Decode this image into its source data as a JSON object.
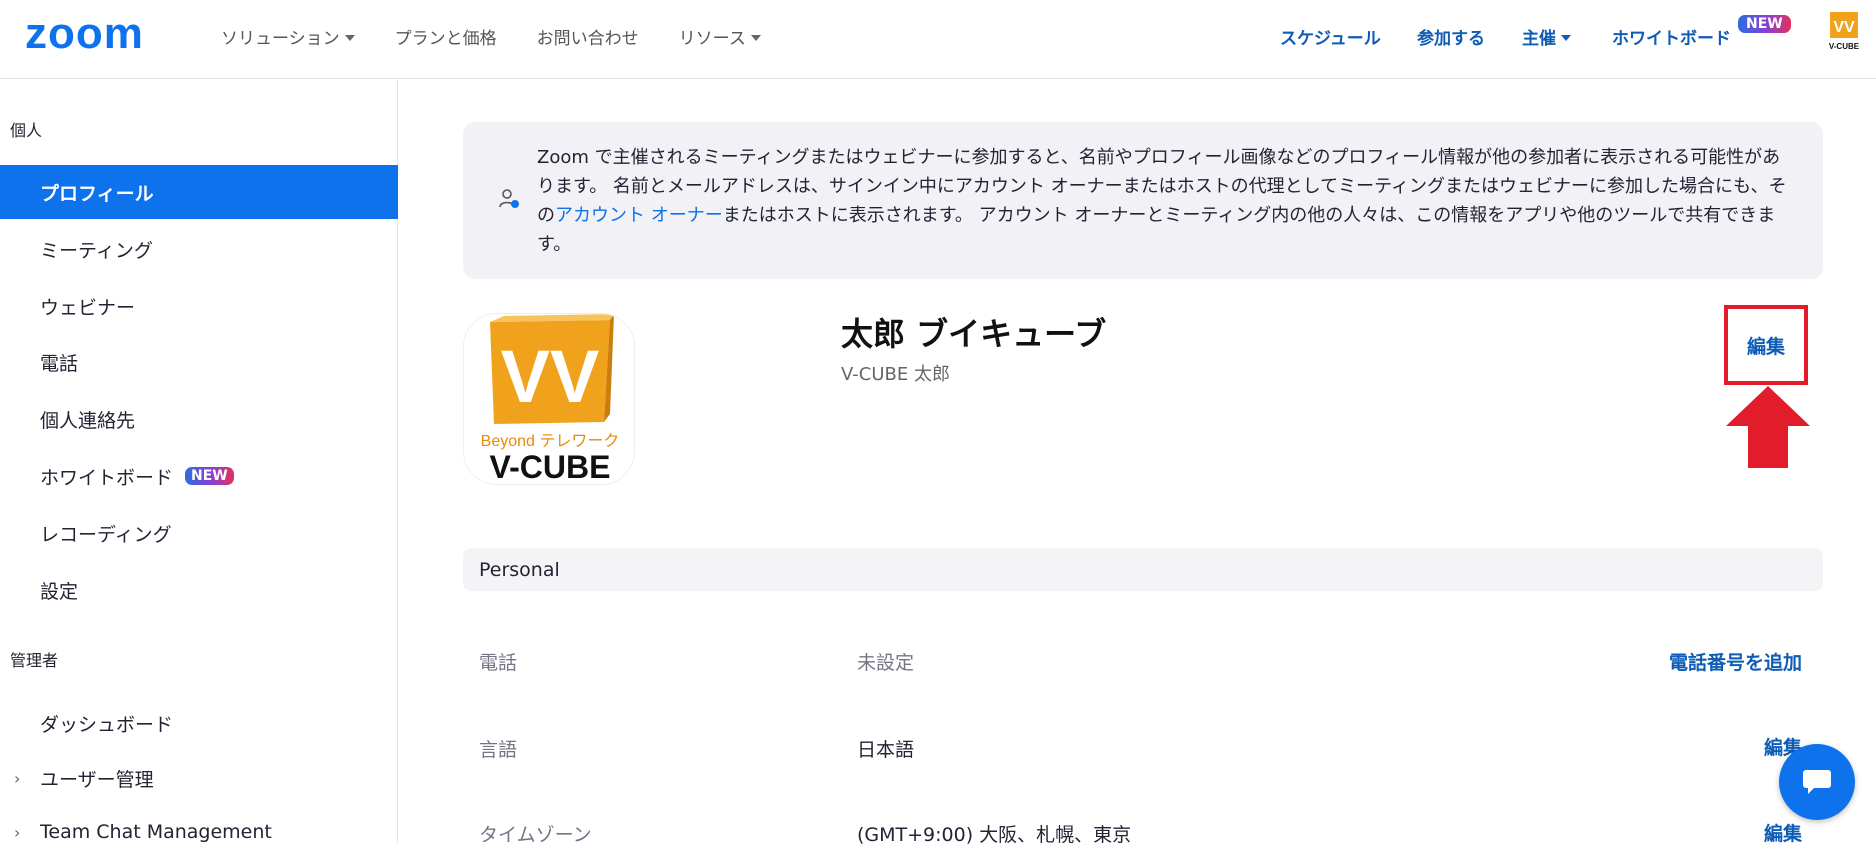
{
  "brand": {
    "logo_text": "zoom",
    "accent": "#0e72ed",
    "link_color": "#0e5cb5",
    "highlight_red": "#e21c2a"
  },
  "topnav": {
    "left": [
      {
        "label": "ソリューション",
        "has_caret": true
      },
      {
        "label": "プランと価格",
        "has_caret": false
      },
      {
        "label": "お問い合わせ",
        "has_caret": false
      },
      {
        "label": "リソース",
        "has_caret": true
      }
    ],
    "right": {
      "schedule": "スケジュール",
      "join": "参加する",
      "host": "主催",
      "whiteboard": "ホワイトボード",
      "new_badge": "NEW"
    },
    "avatar_text": "V-CUBE"
  },
  "sidebar": {
    "personal_heading": "個人",
    "personal_items": [
      "プロフィール",
      "ミーティング",
      "ウェビナー",
      "電話",
      "個人連絡先",
      "ホワイトボード",
      "レコーディング",
      "設定"
    ],
    "active_item": "プロフィール",
    "whiteboard_badge": "NEW",
    "admin_heading": "管理者",
    "admin_items": [
      "ダッシュボード",
      "ユーザー管理",
      "Team Chat Management"
    ]
  },
  "notice": {
    "text_before_link": "Zoom で主催されるミーティングまたはウェビナーに参加すると、名前やプロフィール画像などのプロフィール情報が他の参加者に表示される可能性があります。 名前とメールアドレスは、サインイン中にアカウント オーナーまたはホストの代理としてミーティングまたはウェビナーに参加した場合にも、その",
    "link_text": "アカウント オーナー",
    "text_after_link": "またはホストに表示されます。 アカウント オーナーとミーティング内の他の人々は、この情報をアプリや他のツールで共有できます。"
  },
  "profile": {
    "display_name": "太郎 ブイキューブ",
    "sub_name": "V-CUBE 太郎",
    "edit_label": "編集",
    "avatar_tagline": "Beyond テレワーク",
    "avatar_brand": "V-CUBE"
  },
  "personal_section": {
    "title": "Personal",
    "rows": [
      {
        "label": "電話",
        "value": "未設定",
        "action": "電話番号を追加",
        "muted": true
      },
      {
        "label": "言語",
        "value": "日本語",
        "action": "編集",
        "muted": false
      },
      {
        "label": "タイムゾーン",
        "value": "(GMT+9:00) 大阪、札幌、東京",
        "action": "編集",
        "muted": false
      }
    ]
  }
}
